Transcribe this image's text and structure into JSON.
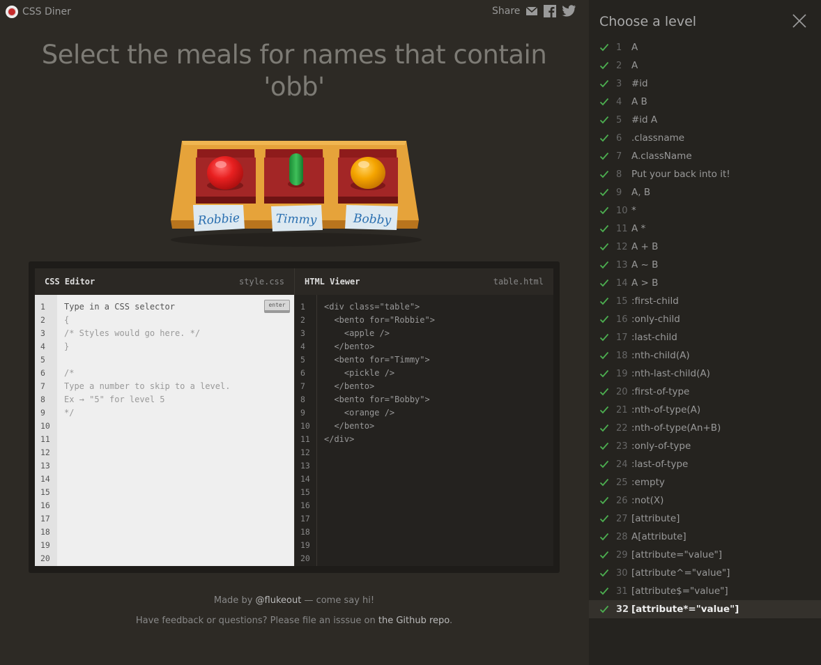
{
  "app": {
    "name": "CSS Diner"
  },
  "share": {
    "label": "Share"
  },
  "instruction": "Select the meals for names that contain 'obb'",
  "table": {
    "bentos": [
      {
        "name": "Robbie",
        "item": "apple"
      },
      {
        "name": "Timmy",
        "item": "pickle"
      },
      {
        "name": "Bobby",
        "item": "orange"
      }
    ]
  },
  "css_editor": {
    "title": "CSS Editor",
    "file": "style.css",
    "placeholder": "Type in a CSS selector",
    "enter_label": "enter",
    "lines": [
      "{",
      "/* Styles would go here. */",
      "}",
      "",
      "/*",
      "Type a number to skip to a level.",
      "Ex → \"5\" for level 5",
      "*/"
    ],
    "line_numbers": [
      "1",
      "2",
      "3",
      "4",
      "5",
      "6",
      "7",
      "8",
      "9",
      "10",
      "11",
      "12",
      "13",
      "14",
      "15",
      "16",
      "17",
      "18",
      "19",
      "20"
    ]
  },
  "html_viewer": {
    "title": "HTML Viewer",
    "file": "table.html",
    "lines": [
      "<div class=\"table\">",
      "  <bento for=\"Robbie\">",
      "    <apple />",
      "  </bento>",
      "  <bento for=\"Timmy\">",
      "    <pickle />",
      "  </bento>",
      "  <bento for=\"Bobby\">",
      "    <orange />",
      "  </bento>",
      "</div>"
    ],
    "line_numbers": [
      "1",
      "2",
      "3",
      "4",
      "5",
      "6",
      "7",
      "8",
      "9",
      "10",
      "11",
      "12",
      "13",
      "14",
      "15",
      "16",
      "17",
      "18",
      "19",
      "20"
    ]
  },
  "footer": {
    "made_by_prefix": "Made by ",
    "made_by_handle": "@flukeout",
    "made_by_suffix": " — come say hi!",
    "feedback_prefix": "Have feedback or questions? Please file an isssue on ",
    "feedback_link": "the Github repo",
    "feedback_suffix": "."
  },
  "sidebar": {
    "title": "Choose a level",
    "current_level": 32,
    "levels": [
      {
        "num": "1",
        "name": "A"
      },
      {
        "num": "2",
        "name": "A"
      },
      {
        "num": "3",
        "name": "#id"
      },
      {
        "num": "4",
        "name": "A  B"
      },
      {
        "num": "5",
        "name": "#id  A"
      },
      {
        "num": "6",
        "name": ".classname"
      },
      {
        "num": "7",
        "name": "A.className"
      },
      {
        "num": "8",
        "name": "Put your back into it!"
      },
      {
        "num": "9",
        "name": "A, B"
      },
      {
        "num": "10",
        "name": "*"
      },
      {
        "num": "11",
        "name": "A  *"
      },
      {
        "num": "12",
        "name": "A + B"
      },
      {
        "num": "13",
        "name": "A ~ B"
      },
      {
        "num": "14",
        "name": "A > B"
      },
      {
        "num": "15",
        "name": ":first-child"
      },
      {
        "num": "16",
        "name": ":only-child"
      },
      {
        "num": "17",
        "name": ":last-child"
      },
      {
        "num": "18",
        "name": ":nth-child(A)"
      },
      {
        "num": "19",
        "name": ":nth-last-child(A)"
      },
      {
        "num": "20",
        "name": ":first-of-type"
      },
      {
        "num": "21",
        "name": ":nth-of-type(A)"
      },
      {
        "num": "22",
        "name": ":nth-of-type(An+B)"
      },
      {
        "num": "23",
        "name": ":only-of-type"
      },
      {
        "num": "24",
        "name": ":last-of-type"
      },
      {
        "num": "25",
        "name": ":empty"
      },
      {
        "num": "26",
        "name": ":not(X)"
      },
      {
        "num": "27",
        "name": "[attribute]"
      },
      {
        "num": "28",
        "name": "A[attribute]"
      },
      {
        "num": "29",
        "name": "[attribute=\"value\"]"
      },
      {
        "num": "30",
        "name": "[attribute^=\"value\"]"
      },
      {
        "num": "31",
        "name": "[attribute$=\"value\"]"
      },
      {
        "num": "32",
        "name": "[attribute*=\"value\"]"
      }
    ]
  },
  "colors": {
    "check": "#4caf50",
    "apple": "#e02020",
    "pickle": "#1e9a3c",
    "orange": "#f5a000",
    "table_wood": "#d6922a"
  }
}
